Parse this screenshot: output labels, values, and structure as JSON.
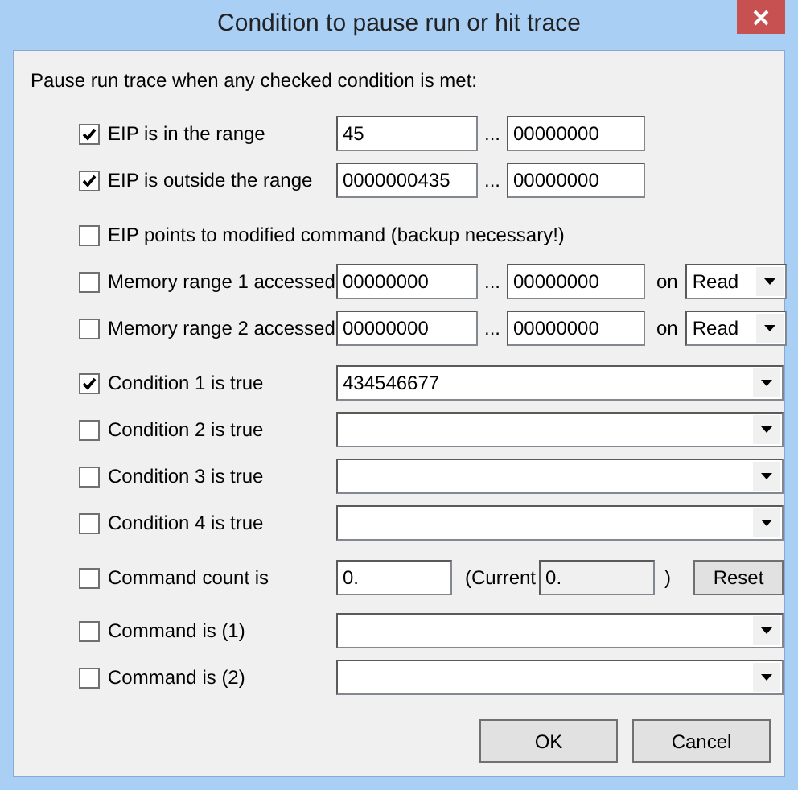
{
  "window": {
    "title": "Condition to pause run or hit trace"
  },
  "intro": "Pause run trace when any checked condition is met:",
  "conditions": [
    {
      "kind": "range",
      "label": "EIP is in the range",
      "checked": true,
      "from": "45",
      "separator": "...",
      "to": "00000000"
    },
    {
      "kind": "range",
      "label": "EIP is outside the range",
      "checked": true,
      "from": "0000000435",
      "separator": "...",
      "to": "00000000"
    },
    {
      "kind": "flag",
      "label": "EIP points to modified command (backup necessary!)",
      "checked": false
    },
    {
      "kind": "memory",
      "label": "Memory range 1 accessed",
      "checked": false,
      "from": "00000000",
      "separator": "...",
      "to": "00000000",
      "on_label": "on",
      "access": "Read"
    },
    {
      "kind": "memory",
      "label": "Memory range 2 accessed",
      "checked": false,
      "from": "00000000",
      "separator": "...",
      "to": "00000000",
      "on_label": "on",
      "access": "Read"
    },
    {
      "kind": "expression",
      "label": "Condition 1 is true",
      "checked": true,
      "value": "434546677"
    },
    {
      "kind": "expression",
      "label": "Condition 2 is true",
      "checked": false
    },
    {
      "kind": "expression",
      "label": "Condition 3 is true",
      "checked": false
    },
    {
      "kind": "expression",
      "label": "Condition 4 is true",
      "checked": false
    },
    {
      "kind": "count",
      "label": "Command count is",
      "checked": false,
      "value": "0.",
      "current_label": "(Current",
      "current": "0.",
      "current_close": ")",
      "button": "Reset"
    },
    {
      "kind": "command",
      "label": "Command is (1)",
      "checked": false
    },
    {
      "kind": "command",
      "label": "Command is (2)",
      "checked": false
    }
  ],
  "buttons": [
    {
      "label": "OK"
    },
    {
      "label": "Cancel"
    }
  ]
}
